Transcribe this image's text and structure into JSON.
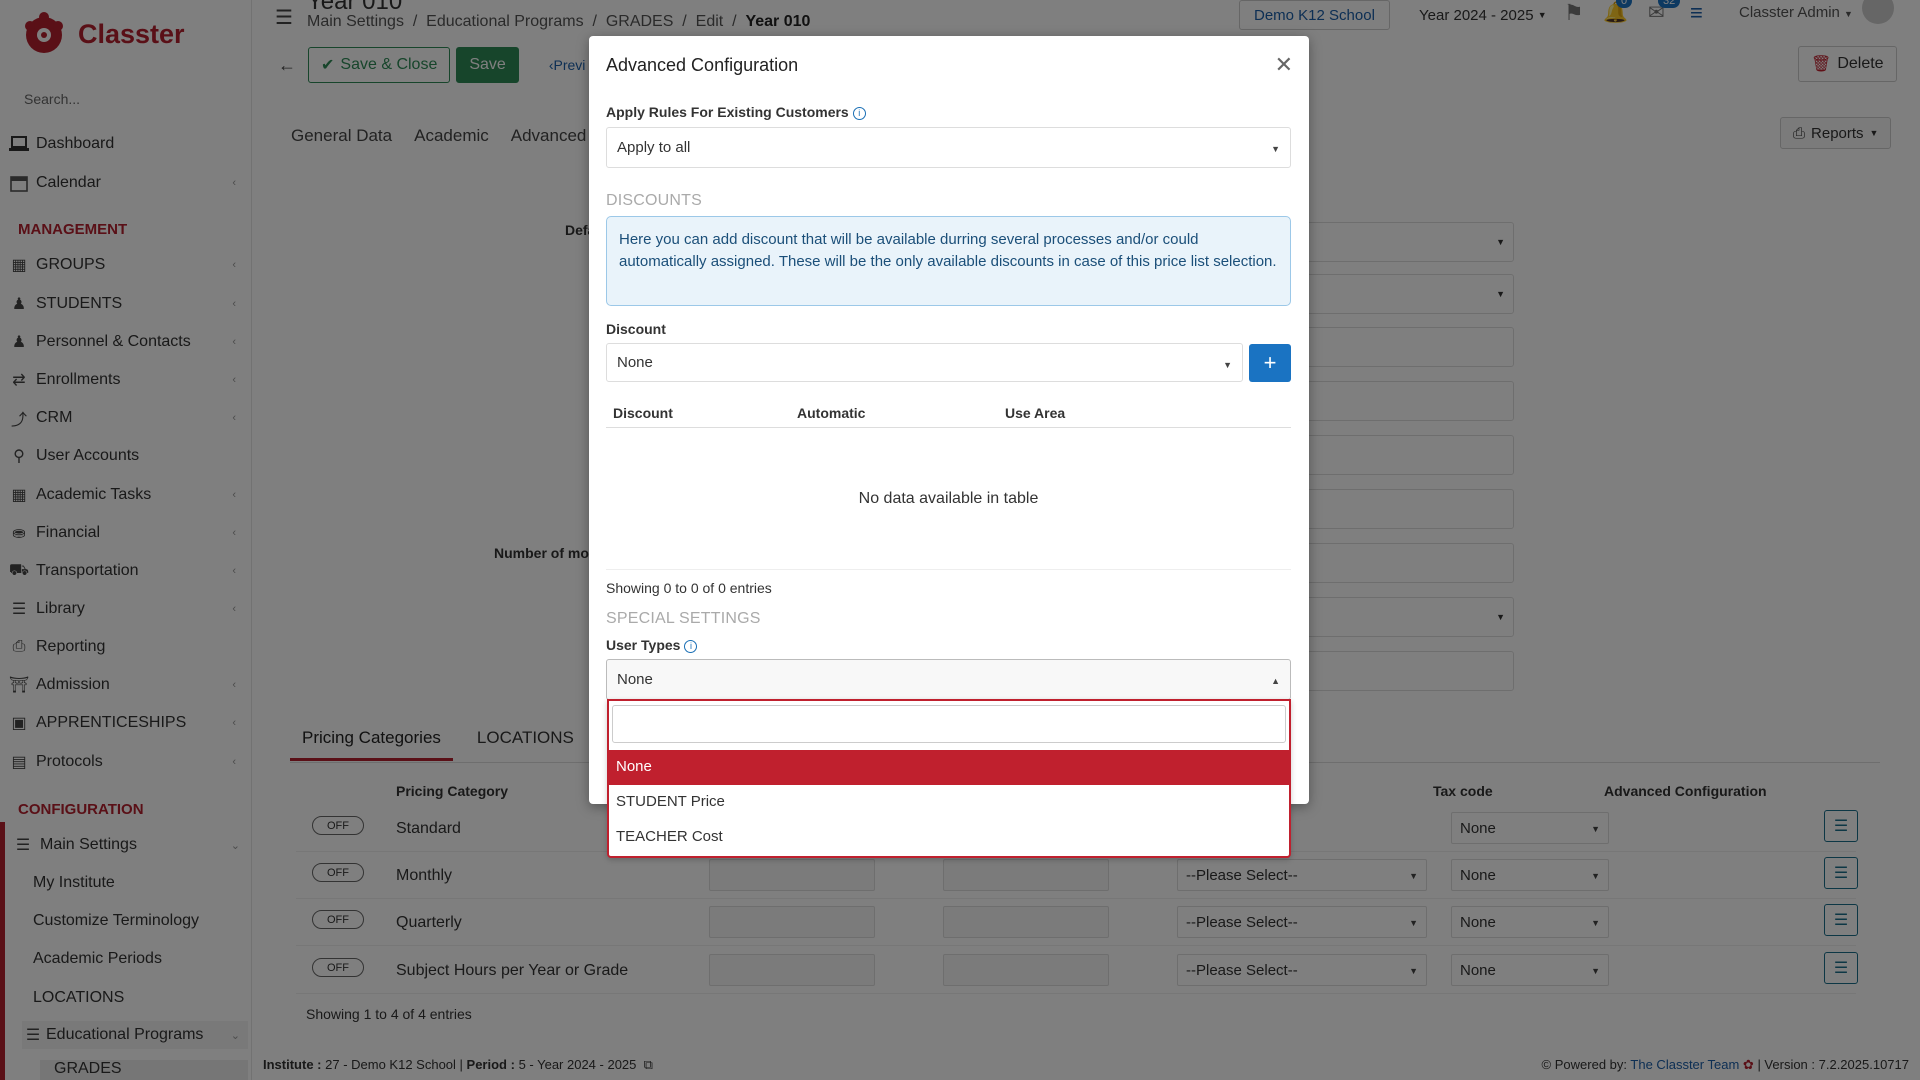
{
  "app": {
    "name": "Classter",
    "brand_color": "#b5202e"
  },
  "sidebar": {
    "search_placeholder": "Search...",
    "items_top": [
      {
        "label": "Dashboard",
        "icon": "laptop-icon"
      },
      {
        "label": "Calendar",
        "icon": "calendar-icon"
      }
    ],
    "management_title": "MANAGEMENT",
    "management": [
      {
        "label": "GROUPS",
        "icon": "groups-icon"
      },
      {
        "label": "STUDENTS",
        "icon": "students-icon"
      },
      {
        "label": "Personnel & Contacts",
        "icon": "person-icon"
      },
      {
        "label": "Enrollments",
        "icon": "arrows-icon"
      },
      {
        "label": "CRM",
        "icon": "chart-icon"
      },
      {
        "label": "User Accounts",
        "icon": "key-icon"
      },
      {
        "label": "Academic Tasks",
        "icon": "grid-icon"
      },
      {
        "label": "Financial",
        "icon": "coins-icon"
      },
      {
        "label": "Transportation",
        "icon": "bus-icon"
      },
      {
        "label": "Library",
        "icon": "books-icon"
      },
      {
        "label": "Reporting",
        "icon": "print-icon"
      },
      {
        "label": "Admission",
        "icon": "building-icon"
      },
      {
        "label": "APPRENTICESHIPS",
        "icon": "box-icon"
      },
      {
        "label": "Protocols",
        "icon": "archive-icon"
      }
    ],
    "configuration_title": "CONFIGURATION",
    "main_settings": "Main Settings",
    "sub_items": [
      "My Institute",
      "Customize Terminology",
      "Academic Periods",
      "LOCATIONS"
    ],
    "educational_programs": "Educational Programs",
    "grades": "GRADES"
  },
  "topbar": {
    "title_fragment": "Year 010",
    "breadcrumb": [
      "Main Settings",
      "Educational Programs",
      "GRADES",
      "Edit"
    ],
    "breadcrumb_current": "Year 010",
    "school": "Demo K12 School",
    "period": "Year 2024 - 2025",
    "notif_count": "0",
    "mail_count": "32",
    "user": "Classter Admin"
  },
  "toolbar": {
    "save_close": "Save & Close",
    "save": "Save",
    "prev": "Previ",
    "delete": "Delete",
    "reports": "Reports"
  },
  "main_tabs": [
    "General Data",
    "Academic",
    "Advanced"
  ],
  "bg_labels": {
    "default_frag": "Defa",
    "number_frag": "Number of mor"
  },
  "pricing": {
    "tabs": [
      "Pricing Categories",
      "LOCATIONS"
    ],
    "headers": {
      "category": "Pricing Category",
      "tax": "Tax code",
      "advanced": "Advanced Configuration"
    },
    "rows": [
      {
        "toggle": "OFF",
        "name": "Standard",
        "please": "",
        "tax": "None"
      },
      {
        "toggle": "OFF",
        "name": "Monthly",
        "please": "--Please Select--",
        "tax": "None"
      },
      {
        "toggle": "OFF",
        "name": "Quarterly",
        "please": "--Please Select--",
        "tax": "None"
      },
      {
        "toggle": "OFF",
        "name": "Subject Hours per Year or Grade",
        "please": "--Please Select--",
        "tax": "None"
      }
    ],
    "showing": "Showing 1 to 4 of 4 entries"
  },
  "footer": {
    "institute_label": "Institute :",
    "institute": "27 - Demo K12 School",
    "period_label": "Period :",
    "period": "5 - Year 2024 - 2025",
    "powered_label": "Powered by:",
    "powered_link": "The Classter Team",
    "version": "| Version : 7.2.2025.10717"
  },
  "modal": {
    "title": "Advanced Configuration",
    "apply_rules_label": "Apply Rules For Existing Customers",
    "apply_rules_value": "Apply to all",
    "discounts_section": "DISCOUNTS",
    "discounts_info": "Here you can add discount that will be available durring several processes and/or could automatically assigned. These will be the only available discounts in case of this price list selection.",
    "discount_label": "Discount",
    "discount_value": "None",
    "table_headers": [
      "Discount",
      "Automatic",
      "Use Area"
    ],
    "empty_text": "No data available in table",
    "showing": "Showing 0 to 0 of 0 entries",
    "special_section": "SPECIAL SETTINGS",
    "user_types_label": "User Types",
    "user_types_value": "None",
    "dropdown_search_value": "",
    "dropdown_options": [
      "None",
      "STUDENT Price",
      "TEACHER Cost"
    ],
    "selected_option": "None"
  },
  "colors": {
    "accent_red": "#c0202e",
    "save_green": "#2e8b57",
    "info_blue": "#1a73c2"
  }
}
